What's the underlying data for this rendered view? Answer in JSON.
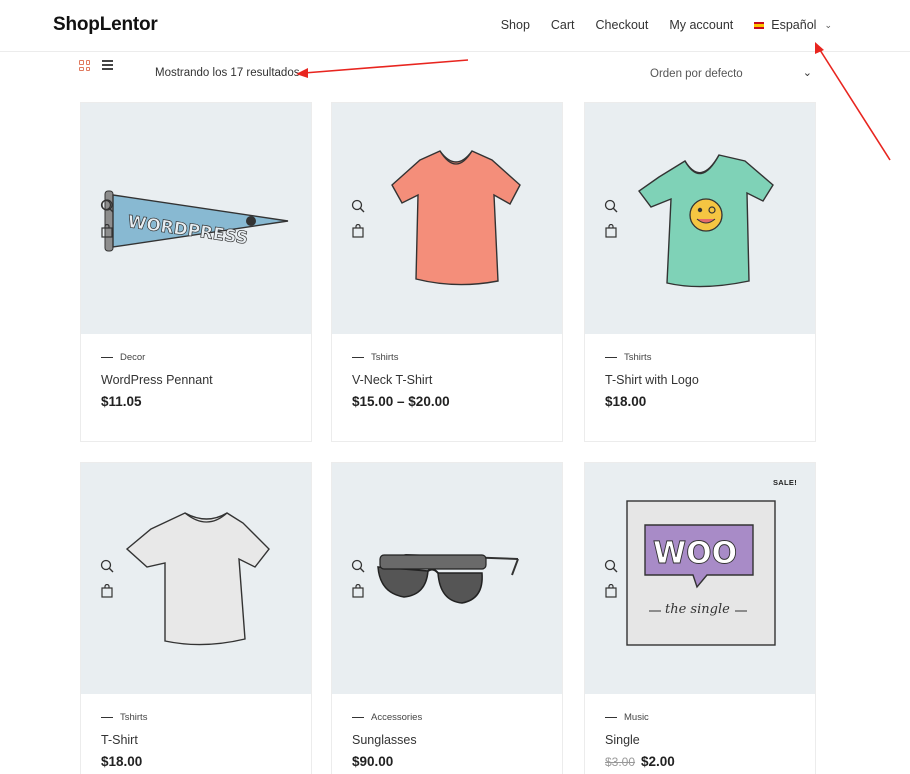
{
  "header": {
    "logo": "ShopLentor",
    "nav": [
      {
        "label": "Shop"
      },
      {
        "label": "Cart"
      },
      {
        "label": "Checkout"
      },
      {
        "label": "My account"
      }
    ],
    "language": {
      "label": "Español",
      "flag": "spain-flag-icon"
    }
  },
  "toolbar": {
    "result_count": "Mostrando los 17 resultados",
    "sort_label": "Orden por defecto",
    "accent_color": "#e07a5f"
  },
  "products": [
    {
      "category": "Decor",
      "title": "WordPress Pennant",
      "price": "$11.05",
      "image": "pennant-image"
    },
    {
      "category": "Tshirts",
      "title": "V-Neck T-Shirt",
      "price": "$15.00 – $20.00",
      "image": "vneck-tshirt-image"
    },
    {
      "category": "Tshirts",
      "title": "T-Shirt with Logo",
      "price": "$18.00",
      "image": "tshirt-logo-image"
    },
    {
      "category": "Tshirts",
      "title": "T-Shirt",
      "price": "$18.00",
      "image": "tshirt-image"
    },
    {
      "category": "Accessories",
      "title": "Sunglasses",
      "price": "$90.00",
      "image": "sunglasses-image"
    },
    {
      "category": "Music",
      "title": "Single",
      "old_price": "$3.00",
      "price": "$2.00",
      "sale_badge": "SALE!",
      "image": "woo-single-image"
    }
  ],
  "annotation_color": "#e8251f"
}
